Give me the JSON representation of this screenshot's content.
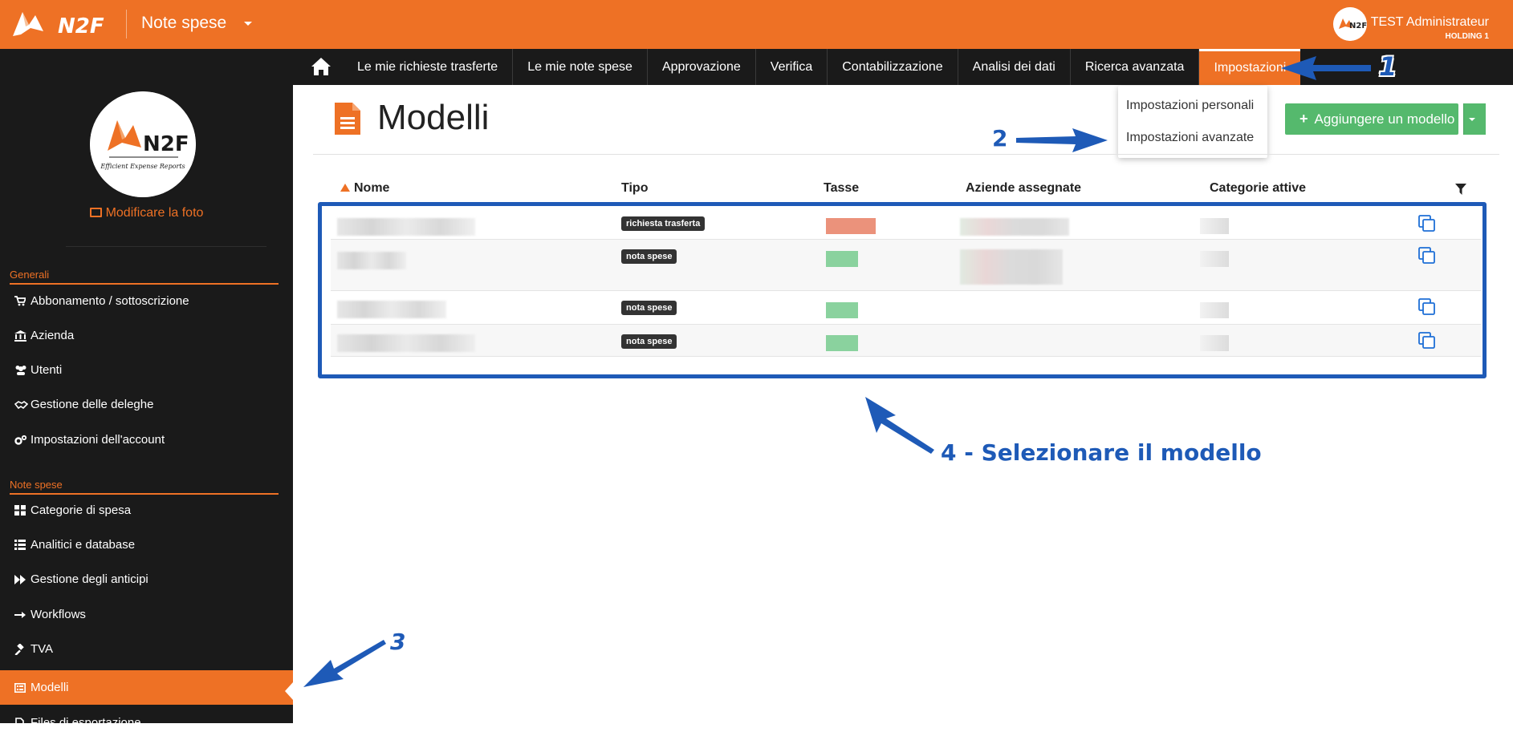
{
  "header": {
    "module": "Note spese",
    "user_name": "TEST Administrateur",
    "user_company": "HOLDING 1",
    "brand_color": "#ee7125"
  },
  "nav": {
    "items": [
      {
        "label": "Le mie richieste trasferte"
      },
      {
        "label": "Le mie note spese"
      },
      {
        "label": "Approvazione"
      },
      {
        "label": "Verifica"
      },
      {
        "label": "Contabilizzazione"
      },
      {
        "label": "Analisi dei dati"
      },
      {
        "label": "Ricerca avanzata"
      },
      {
        "label": "Impostazioni"
      }
    ],
    "dropdown": [
      "Impostazioni personali",
      "Impostazioni avanzate"
    ]
  },
  "sidebar": {
    "photo_link": "Modificare la foto",
    "section_general": "Generali",
    "general_items": [
      {
        "label": "Abbonamento / sottoscrizione",
        "icon": "cart-icon"
      },
      {
        "label": "Azienda",
        "icon": "bank-icon"
      },
      {
        "label": "Utenti",
        "icon": "users-icon"
      },
      {
        "label": "Gestione delle deleghe",
        "icon": "handshake-icon"
      },
      {
        "label": "Impostazioni dell'account",
        "icon": "cogs-icon"
      }
    ],
    "section_notes": "Note spese",
    "notes_items": [
      {
        "label": "Categorie di spesa",
        "icon": "grid-icon"
      },
      {
        "label": "Analitici e database",
        "icon": "list-icon"
      },
      {
        "label": "Gestione degli anticipi",
        "icon": "fast-forward-icon"
      },
      {
        "label": "Workflows",
        "icon": "arrow-right-icon"
      },
      {
        "label": "TVA",
        "icon": "gavel-icon"
      },
      {
        "label": "Modelli",
        "icon": "template-icon"
      },
      {
        "label": "Files di esportazione",
        "icon": "file-export-icon"
      }
    ]
  },
  "main": {
    "title": "Modelli",
    "add_button": "Aggiungere un modello",
    "columns": [
      "Nome",
      "Tipo",
      "Tasse",
      "Aziende assegnate",
      "Categorie attive"
    ],
    "rows": [
      {
        "type": "richiesta trasferta"
      },
      {
        "type": "nota spese"
      },
      {
        "type": "nota spese"
      },
      {
        "type": "nota spese"
      }
    ]
  },
  "annotations": {
    "a1": "1",
    "a2": "2",
    "a3": "3",
    "a4": "4 - Selezionare il modello",
    "color": "#1e5ab7"
  }
}
